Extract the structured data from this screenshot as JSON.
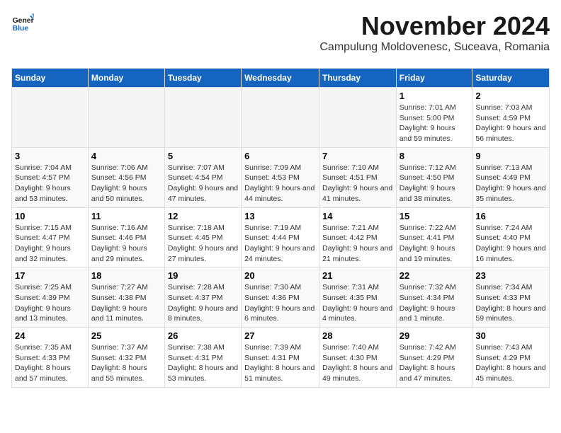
{
  "logo": {
    "general": "General",
    "blue": "Blue"
  },
  "header": {
    "month_year": "November 2024",
    "location": "Campulung Moldovenesc, Suceava, Romania"
  },
  "days_of_week": [
    "Sunday",
    "Monday",
    "Tuesday",
    "Wednesday",
    "Thursday",
    "Friday",
    "Saturday"
  ],
  "weeks": [
    [
      {
        "day": "",
        "info": ""
      },
      {
        "day": "",
        "info": ""
      },
      {
        "day": "",
        "info": ""
      },
      {
        "day": "",
        "info": ""
      },
      {
        "day": "",
        "info": ""
      },
      {
        "day": "1",
        "info": "Sunrise: 7:01 AM\nSunset: 5:00 PM\nDaylight: 9 hours and 59 minutes."
      },
      {
        "day": "2",
        "info": "Sunrise: 7:03 AM\nSunset: 4:59 PM\nDaylight: 9 hours and 56 minutes."
      }
    ],
    [
      {
        "day": "3",
        "info": "Sunrise: 7:04 AM\nSunset: 4:57 PM\nDaylight: 9 hours and 53 minutes."
      },
      {
        "day": "4",
        "info": "Sunrise: 7:06 AM\nSunset: 4:56 PM\nDaylight: 9 hours and 50 minutes."
      },
      {
        "day": "5",
        "info": "Sunrise: 7:07 AM\nSunset: 4:54 PM\nDaylight: 9 hours and 47 minutes."
      },
      {
        "day": "6",
        "info": "Sunrise: 7:09 AM\nSunset: 4:53 PM\nDaylight: 9 hours and 44 minutes."
      },
      {
        "day": "7",
        "info": "Sunrise: 7:10 AM\nSunset: 4:51 PM\nDaylight: 9 hours and 41 minutes."
      },
      {
        "day": "8",
        "info": "Sunrise: 7:12 AM\nSunset: 4:50 PM\nDaylight: 9 hours and 38 minutes."
      },
      {
        "day": "9",
        "info": "Sunrise: 7:13 AM\nSunset: 4:49 PM\nDaylight: 9 hours and 35 minutes."
      }
    ],
    [
      {
        "day": "10",
        "info": "Sunrise: 7:15 AM\nSunset: 4:47 PM\nDaylight: 9 hours and 32 minutes."
      },
      {
        "day": "11",
        "info": "Sunrise: 7:16 AM\nSunset: 4:46 PM\nDaylight: 9 hours and 29 minutes."
      },
      {
        "day": "12",
        "info": "Sunrise: 7:18 AM\nSunset: 4:45 PM\nDaylight: 9 hours and 27 minutes."
      },
      {
        "day": "13",
        "info": "Sunrise: 7:19 AM\nSunset: 4:44 PM\nDaylight: 9 hours and 24 minutes."
      },
      {
        "day": "14",
        "info": "Sunrise: 7:21 AM\nSunset: 4:42 PM\nDaylight: 9 hours and 21 minutes."
      },
      {
        "day": "15",
        "info": "Sunrise: 7:22 AM\nSunset: 4:41 PM\nDaylight: 9 hours and 19 minutes."
      },
      {
        "day": "16",
        "info": "Sunrise: 7:24 AM\nSunset: 4:40 PM\nDaylight: 9 hours and 16 minutes."
      }
    ],
    [
      {
        "day": "17",
        "info": "Sunrise: 7:25 AM\nSunset: 4:39 PM\nDaylight: 9 hours and 13 minutes."
      },
      {
        "day": "18",
        "info": "Sunrise: 7:27 AM\nSunset: 4:38 PM\nDaylight: 9 hours and 11 minutes."
      },
      {
        "day": "19",
        "info": "Sunrise: 7:28 AM\nSunset: 4:37 PM\nDaylight: 9 hours and 8 minutes."
      },
      {
        "day": "20",
        "info": "Sunrise: 7:30 AM\nSunset: 4:36 PM\nDaylight: 9 hours and 6 minutes."
      },
      {
        "day": "21",
        "info": "Sunrise: 7:31 AM\nSunset: 4:35 PM\nDaylight: 9 hours and 4 minutes."
      },
      {
        "day": "22",
        "info": "Sunrise: 7:32 AM\nSunset: 4:34 PM\nDaylight: 9 hours and 1 minute."
      },
      {
        "day": "23",
        "info": "Sunrise: 7:34 AM\nSunset: 4:33 PM\nDaylight: 8 hours and 59 minutes."
      }
    ],
    [
      {
        "day": "24",
        "info": "Sunrise: 7:35 AM\nSunset: 4:33 PM\nDaylight: 8 hours and 57 minutes."
      },
      {
        "day": "25",
        "info": "Sunrise: 7:37 AM\nSunset: 4:32 PM\nDaylight: 8 hours and 55 minutes."
      },
      {
        "day": "26",
        "info": "Sunrise: 7:38 AM\nSunset: 4:31 PM\nDaylight: 8 hours and 53 minutes."
      },
      {
        "day": "27",
        "info": "Sunrise: 7:39 AM\nSunset: 4:31 PM\nDaylight: 8 hours and 51 minutes."
      },
      {
        "day": "28",
        "info": "Sunrise: 7:40 AM\nSunset: 4:30 PM\nDaylight: 8 hours and 49 minutes."
      },
      {
        "day": "29",
        "info": "Sunrise: 7:42 AM\nSunset: 4:29 PM\nDaylight: 8 hours and 47 minutes."
      },
      {
        "day": "30",
        "info": "Sunrise: 7:43 AM\nSunset: 4:29 PM\nDaylight: 8 hours and 45 minutes."
      }
    ]
  ]
}
